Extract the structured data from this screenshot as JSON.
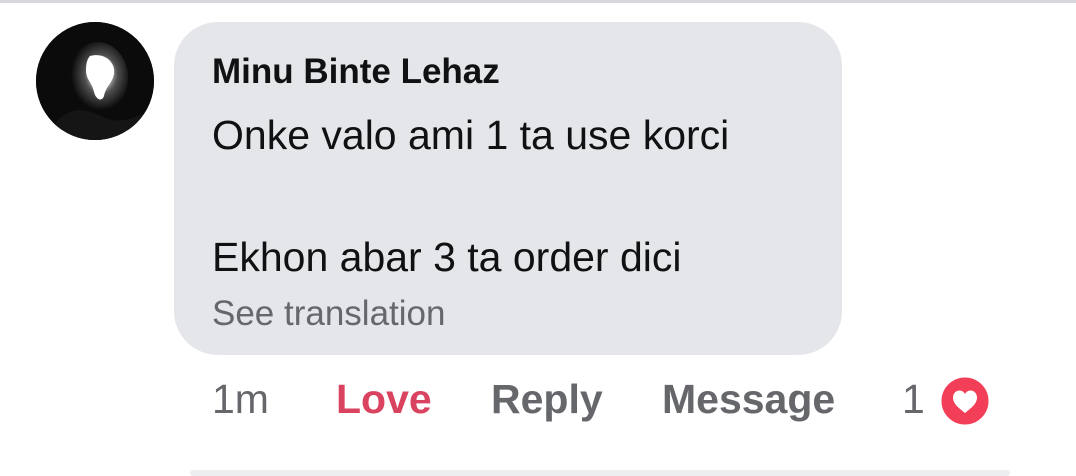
{
  "comment": {
    "author": "Minu Binte Lehaz",
    "text_line_1": "Onke valo ami 1 ta use korci",
    "text_line_2": "Ekhon abar 3 ta order dici",
    "see_translation": "See translation"
  },
  "actions": {
    "time": "1m",
    "love": "Love",
    "reply": "Reply",
    "message": "Message",
    "reaction_count": "1"
  },
  "colors": {
    "bubble": "#e4e6ea",
    "love_active": "#d9435f",
    "muted_text": "#65676b",
    "heart_badge": "#f33e58"
  },
  "icons": {
    "avatar": "profile-photo",
    "reaction": "heart-icon"
  }
}
